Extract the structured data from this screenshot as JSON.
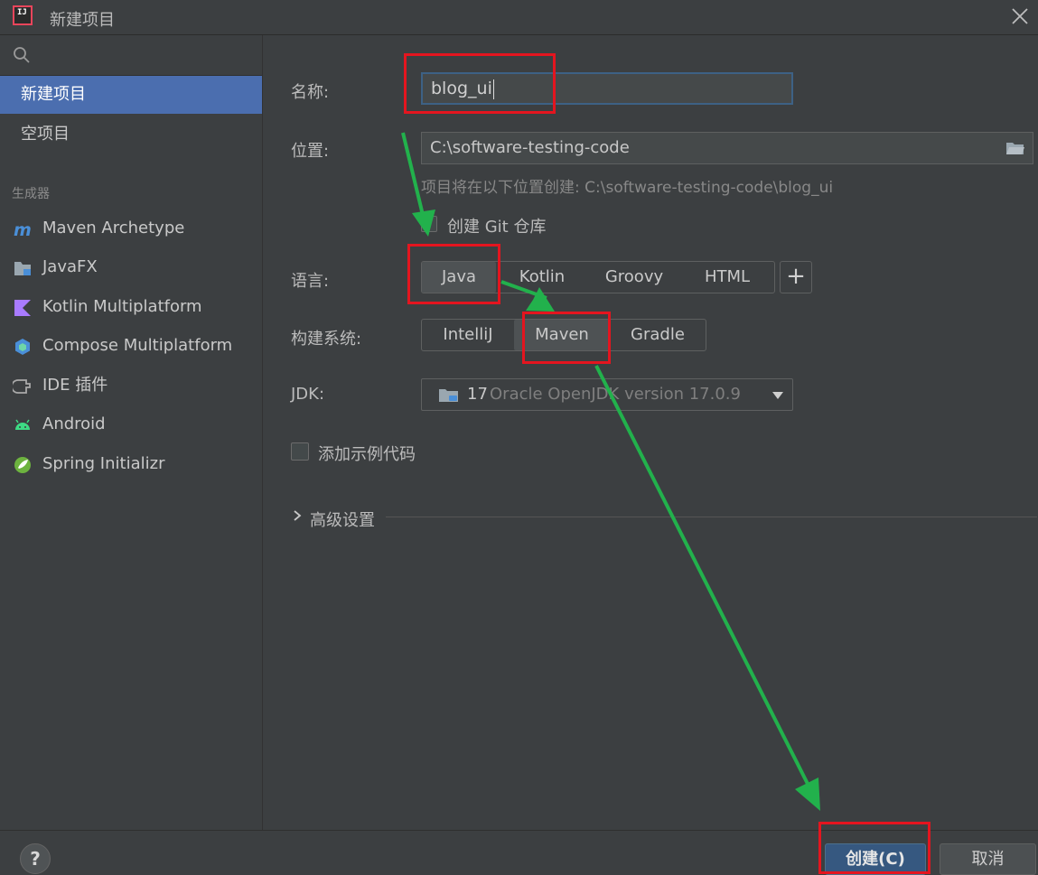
{
  "window": {
    "title": "新建项目",
    "app_icon_text": "IJ"
  },
  "sidebar": {
    "items": [
      {
        "label": "新建项目"
      },
      {
        "label": "空项目"
      }
    ],
    "generators_label": "生成器",
    "generators": [
      {
        "label": "Maven Archetype",
        "icon": "maven-icon"
      },
      {
        "label": "JavaFX",
        "icon": "javafx-icon"
      },
      {
        "label": "Kotlin Multiplatform",
        "icon": "kotlin-icon"
      },
      {
        "label": "Compose Multiplatform",
        "icon": "compose-icon"
      },
      {
        "label": "IDE 插件",
        "icon": "plugin-icon"
      },
      {
        "label": "Android",
        "icon": "android-icon"
      },
      {
        "label": "Spring Initializr",
        "icon": "spring-icon"
      }
    ]
  },
  "form": {
    "name_label": "名称:",
    "name_value": "blog_ui",
    "location_label": "位置:",
    "location_value": "C:\\software-testing-code",
    "location_hint": "项目将在以下位置创建: C:\\software-testing-code\\blog_ui",
    "git_label": "创建 Git 仓库",
    "language_label": "语言:",
    "languages": [
      "Java",
      "Kotlin",
      "Groovy",
      "HTML"
    ],
    "language_selected": "Java",
    "add_language": "+",
    "build_label": "构建系统:",
    "build_systems": [
      "IntelliJ",
      "Maven",
      "Gradle"
    ],
    "build_selected": "Maven",
    "jdk_label": "JDK:",
    "jdk_version": "17",
    "jdk_name": "Oracle OpenJDK version 17.0.9",
    "sample_code_label": "添加示例代码",
    "advanced_label": "高级设置"
  },
  "footer": {
    "help": "?",
    "create": "创建(C)",
    "cancel": "取消"
  },
  "colors": {
    "accent_selection": "#4b6eaf",
    "annotation_red": "#e4151f",
    "annotation_green": "#22b14c",
    "primary_button": "#365880"
  }
}
